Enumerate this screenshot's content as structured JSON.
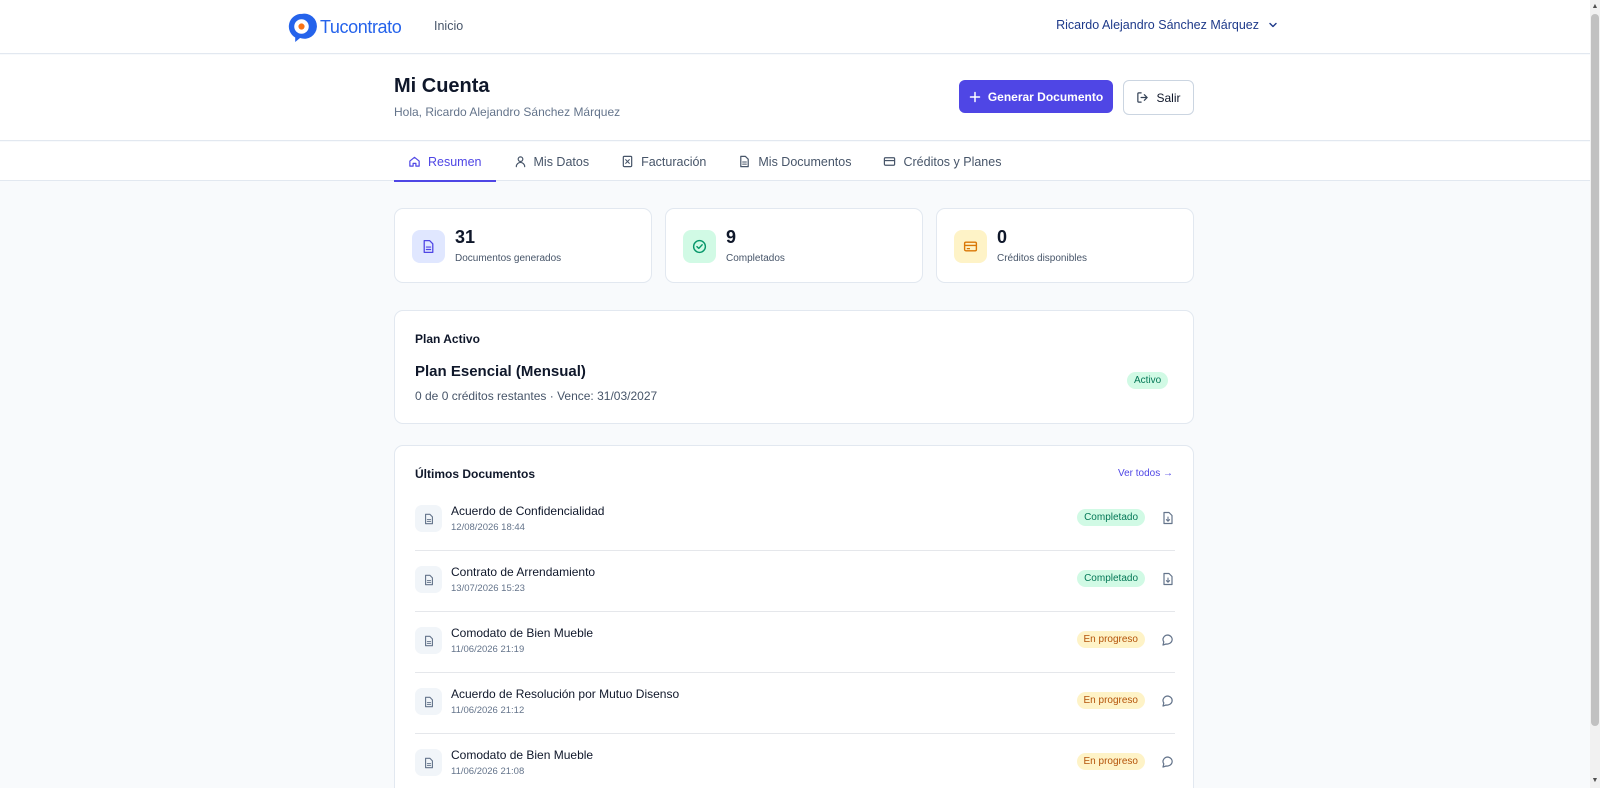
{
  "brand": {
    "name": "Tucontrato",
    "color": "#2563eb",
    "dot_color": "#f97316"
  },
  "nav": {
    "inicio": "Inicio",
    "user_name": "Ricardo Alejandro Sánchez Márquez"
  },
  "header": {
    "title": "Mi Cuenta",
    "greeting": "Hola, Ricardo Alejandro Sánchez Márquez",
    "generate_label": "Generar Documento",
    "logout_label": "Salir"
  },
  "tabs": [
    {
      "label": "Resumen",
      "icon": "home-icon",
      "active": true
    },
    {
      "label": "Mis Datos",
      "icon": "user-icon",
      "active": false
    },
    {
      "label": "Facturación",
      "icon": "receipt-icon",
      "active": false
    },
    {
      "label": "Mis Documentos",
      "icon": "file-icon",
      "active": false
    },
    {
      "label": "Créditos y Planes",
      "icon": "credit-card-icon",
      "active": false
    }
  ],
  "stats": [
    {
      "value": "31",
      "label": "Documentos generados",
      "icon": "document-icon",
      "bg": "#e0e7ff",
      "fg": "#4f46e5"
    },
    {
      "value": "9",
      "label": "Completados",
      "icon": "check-circle-icon",
      "bg": "#d1fae5",
      "fg": "#059669"
    },
    {
      "value": "0",
      "label": "Créditos disponibles",
      "icon": "credit-card-icon",
      "bg": "#fef3c7",
      "fg": "#d97706"
    }
  ],
  "plan": {
    "heading": "Plan Activo",
    "name": "Plan Esencial (Mensual)",
    "info": "0 de 0 créditos restantes · Vence: 31/03/2027",
    "status": "Activo"
  },
  "documents": {
    "heading": "Últimos Documentos",
    "see_all": "Ver todos →",
    "items": [
      {
        "title": "Acuerdo de Confidencialidad",
        "date": "12/08/2026 18:44",
        "status": "Completado",
        "state": "done",
        "action_icon": "download-file-icon"
      },
      {
        "title": "Contrato de Arrendamiento",
        "date": "13/07/2026 15:23",
        "status": "Completado",
        "state": "done",
        "action_icon": "download-file-icon"
      },
      {
        "title": "Comodato de Bien Mueble",
        "date": "11/06/2026 21:19",
        "status": "En progreso",
        "state": "progress",
        "action_icon": "chat-bubble-icon"
      },
      {
        "title": "Acuerdo de Resolución por Mutuo Disenso",
        "date": "11/06/2026 21:12",
        "status": "En progreso",
        "state": "progress",
        "action_icon": "chat-bubble-icon"
      },
      {
        "title": "Comodato de Bien Mueble",
        "date": "11/06/2026 21:08",
        "status": "En progreso",
        "state": "progress",
        "action_icon": "chat-bubble-icon"
      }
    ]
  },
  "colors": {
    "primary": "#4f46e5",
    "success": "#047857",
    "warning": "#b45309"
  }
}
